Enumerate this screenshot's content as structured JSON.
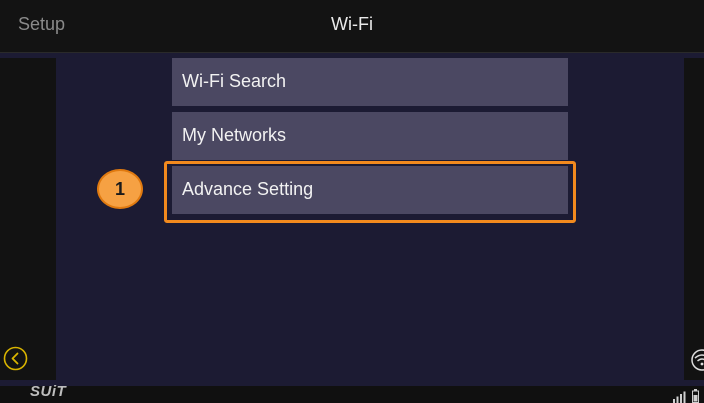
{
  "header": {
    "back_label": "Setup",
    "title": "Wi-Fi"
  },
  "menu": {
    "items": [
      {
        "label": "Wi-Fi Search"
      },
      {
        "label": "My Networks"
      },
      {
        "label": "Advance Setting"
      }
    ]
  },
  "annotation": {
    "step_number": "1",
    "highlighted_item": "Advance Setting",
    "highlight_color": "#f28a1e",
    "badge_color": "#f6a143"
  },
  "footer": {
    "brand_logo_text": "SUiT",
    "back_icon": "chevron-left-circle-icon",
    "wifi_icon": "wifi-icon",
    "signal_icon": "signal-bars-icon",
    "battery_icon": "battery-icon"
  },
  "colors": {
    "background": "#1c1b33",
    "header": "#131313",
    "menu_item": "#4b4862",
    "accent_yellow": "#d9b400"
  }
}
